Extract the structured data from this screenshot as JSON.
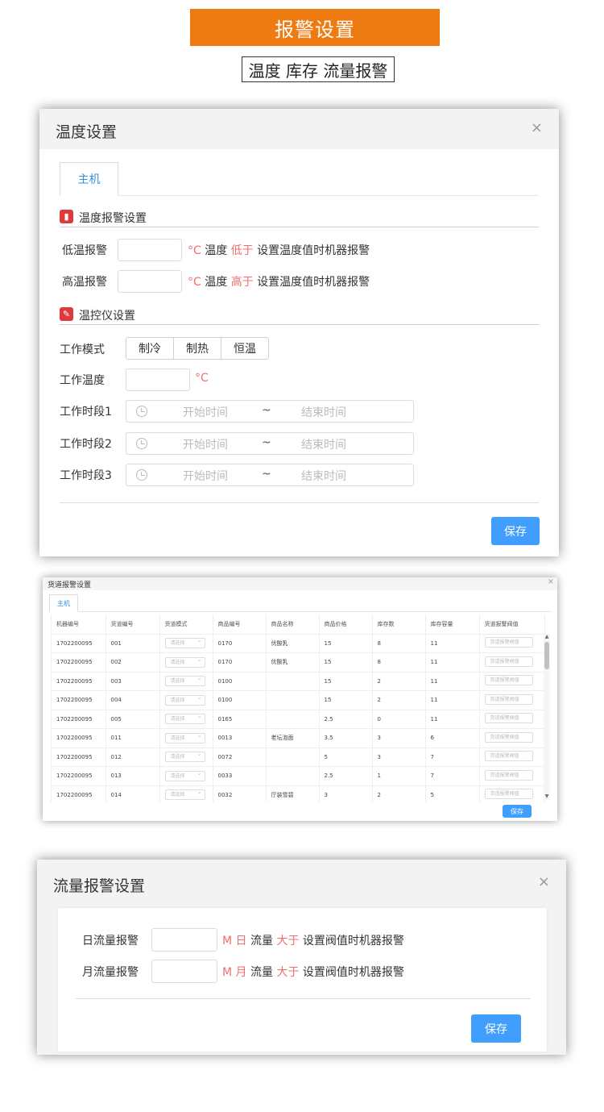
{
  "header": {
    "banner": "报警设置",
    "subtitle": "温度 库存 流量报警"
  },
  "temp_dialog": {
    "title": "温度设置",
    "close": "×",
    "tab": "主机",
    "alarm_section": "温度报警设置",
    "low": {
      "label": "低温报警",
      "value": "",
      "unit": "°C",
      "w1": "温度",
      "cmp": "低于",
      "rest": "设置温度值时机器报警"
    },
    "high": {
      "label": "高温报警",
      "value": "",
      "unit": "°C",
      "w1": "温度",
      "cmp": "高于",
      "rest": "设置温度值时机器报警"
    },
    "ctrl_section": "温控仪设置",
    "mode": {
      "label": "工作模式",
      "options": [
        "制冷",
        "制热",
        "恒温"
      ]
    },
    "work_temp": {
      "label": "工作温度",
      "value": "",
      "unit": "°C"
    },
    "periods": [
      {
        "label": "工作时段1",
        "start": "开始时间",
        "sep": "~",
        "end": "结束时间"
      },
      {
        "label": "工作时段2",
        "start": "开始时间",
        "sep": "~",
        "end": "结束时间"
      },
      {
        "label": "工作时段3",
        "start": "开始时间",
        "sep": "~",
        "end": "结束时间"
      }
    ],
    "save": "保存"
  },
  "channel_dialog": {
    "title": "货道报警设置",
    "close": "×",
    "tab": "主机",
    "columns": [
      "机器编号",
      "货道编号",
      "货道模式",
      "商品编号",
      "商品名称",
      "商品价格",
      "库存数",
      "库存容量",
      "货道报警阀值"
    ],
    "select_placeholder": "请选择",
    "input_placeholder": "货道报警阀值",
    "rows": [
      {
        "machine": "1702200095",
        "channel": "001",
        "product": "0170",
        "name": "优酸乳",
        "price": "15",
        "stock": "8",
        "capacity": "11"
      },
      {
        "machine": "1702200095",
        "channel": "002",
        "product": "0170",
        "name": "优酸乳",
        "price": "15",
        "stock": "8",
        "capacity": "11"
      },
      {
        "machine": "1702200095",
        "channel": "003",
        "product": "0100",
        "name": "",
        "price": "15",
        "stock": "2",
        "capacity": "11"
      },
      {
        "machine": "1702200095",
        "channel": "004",
        "product": "0100",
        "name": "",
        "price": "15",
        "stock": "2",
        "capacity": "11"
      },
      {
        "machine": "1702200095",
        "channel": "005",
        "product": "0165",
        "name": "",
        "price": "2.5",
        "stock": "0",
        "capacity": "11"
      },
      {
        "machine": "1702200095",
        "channel": "011",
        "product": "0013",
        "name": "老坛泡面",
        "price": "3.5",
        "stock": "3",
        "capacity": "6"
      },
      {
        "machine": "1702200095",
        "channel": "012",
        "product": "0072",
        "name": "",
        "price": "5",
        "stock": "3",
        "capacity": "7"
      },
      {
        "machine": "1702200095",
        "channel": "013",
        "product": "0033",
        "name": "",
        "price": "2.5",
        "stock": "1",
        "capacity": "7"
      },
      {
        "machine": "1702200095",
        "channel": "014",
        "product": "0032",
        "name": "厅装雪碧",
        "price": "3",
        "stock": "2",
        "capacity": "5"
      }
    ],
    "save": "保存"
  },
  "flow_dialog": {
    "title": "流量报警设置",
    "close": "×",
    "daily": {
      "label": "日流量报警",
      "value": "",
      "unit": "M",
      "period": "日",
      "w1": "流量",
      "cmp": "大于",
      "rest": "设置阀值时机器报警"
    },
    "monthly": {
      "label": "月流量报警",
      "value": "",
      "unit": "M",
      "period": "月",
      "w1": "流量",
      "cmp": "大于",
      "rest": "设置阀值时机器报警"
    },
    "save": "保存"
  },
  "colors": {
    "banner": "#ee7a12",
    "accent": "#409eff",
    "warn": "#f56c6c",
    "section_icon": "#e0393b"
  }
}
